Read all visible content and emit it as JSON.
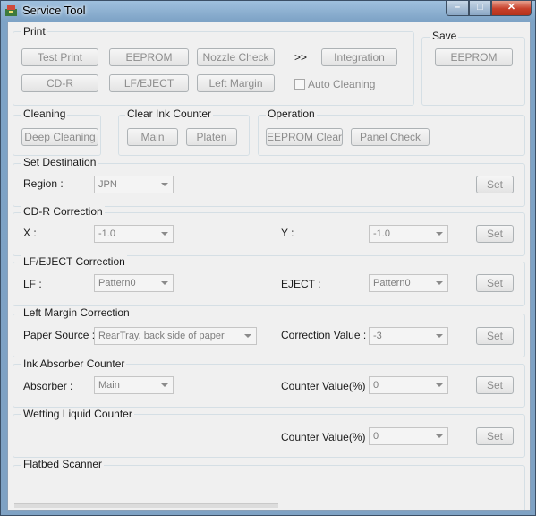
{
  "window": {
    "title": "Service Tool",
    "minimize": "–",
    "maximize": "□",
    "close": "✕"
  },
  "print": {
    "label": "Print",
    "buttons": [
      "Test Print",
      "EEPROM",
      "Nozzle Check",
      "Integration",
      "CD-R",
      "LF/EJECT",
      "Left Margin"
    ],
    "arrows": ">>",
    "auto_cleaning": "Auto Cleaning"
  },
  "save": {
    "label": "Save",
    "eeprom": "EEPROM"
  },
  "cleaning": {
    "label": "Cleaning",
    "deep": "Deep Cleaning"
  },
  "ink_counter": {
    "label": "Clear Ink Counter",
    "main": "Main",
    "platen": "Platen"
  },
  "operation": {
    "label": "Operation",
    "eeprom_clear": "EEPROM Clear",
    "panel_check": "Panel Check"
  },
  "destination": {
    "label": "Set Destination",
    "region_label": "Region :",
    "region_value": "JPN",
    "set": "Set"
  },
  "cdr": {
    "label": "CD-R Correction",
    "x_label": "X :",
    "x_value": "-1.0",
    "y_label": "Y :",
    "y_value": "-1.0",
    "set": "Set"
  },
  "lfeject": {
    "label": "LF/EJECT Correction",
    "lf_label": "LF :",
    "lf_value": "Pattern0",
    "eject_label": "EJECT :",
    "eject_value": "Pattern0",
    "set": "Set"
  },
  "left_margin": {
    "label": "Left Margin Correction",
    "source_label": "Paper Source :",
    "source_value": "RearTray, back side of paper",
    "corr_label": "Correction Value :",
    "corr_value": "-3",
    "set": "Set"
  },
  "absorber": {
    "label": "Ink Absorber Counter",
    "absorber_label": "Absorber :",
    "absorber_value": "Main",
    "counter_label": "Counter Value(%) :",
    "counter_value": "0",
    "set": "Set"
  },
  "wetting": {
    "label": "Wetting Liquid Counter",
    "counter_label": "Counter Value(%) :",
    "counter_value": "0",
    "set": "Set"
  },
  "flatbed": {
    "label": "Flatbed Scanner"
  }
}
